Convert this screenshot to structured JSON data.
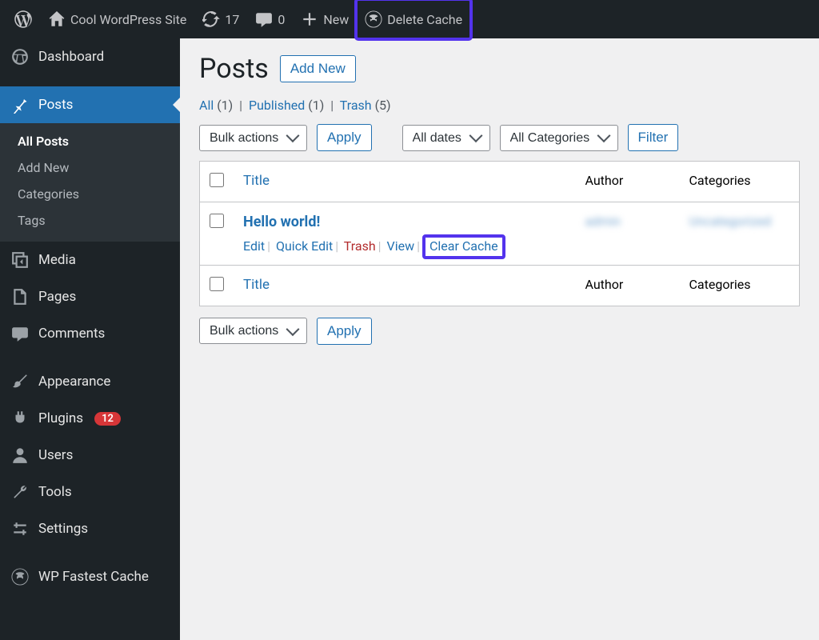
{
  "adminbar": {
    "site_name": "Cool WordPress Site",
    "updates_count": "17",
    "comments_count": "0",
    "new_label": "New",
    "delete_cache_label": "Delete Cache"
  },
  "sidebar": {
    "items": [
      {
        "id": "dashboard",
        "label": "Dashboard"
      },
      {
        "id": "posts",
        "label": "Posts"
      },
      {
        "id": "media",
        "label": "Media"
      },
      {
        "id": "pages",
        "label": "Pages"
      },
      {
        "id": "comments",
        "label": "Comments"
      },
      {
        "id": "appearance",
        "label": "Appearance"
      },
      {
        "id": "plugins",
        "label": "Plugins"
      },
      {
        "id": "users",
        "label": "Users"
      },
      {
        "id": "tools",
        "label": "Tools"
      },
      {
        "id": "settings",
        "label": "Settings"
      },
      {
        "id": "wpfc",
        "label": "WP Fastest Cache"
      }
    ],
    "plugins_badge": "12",
    "posts_submenu": {
      "all": "All Posts",
      "add_new": "Add New",
      "categories": "Categories",
      "tags": "Tags"
    }
  },
  "page": {
    "title": "Posts",
    "add_new": "Add New"
  },
  "views": {
    "all_label": "All",
    "all_count": "(1)",
    "published_label": "Published",
    "published_count": "(1)",
    "trash_label": "Trash",
    "trash_count": "(5)"
  },
  "filters": {
    "bulk_actions": "Bulk actions",
    "apply": "Apply",
    "all_dates": "All dates",
    "all_categories": "All Categories",
    "filter": "Filter"
  },
  "table": {
    "col_title": "Title",
    "col_author": "Author",
    "col_categories": "Categories",
    "row1": {
      "title": "Hello world!",
      "author_blur": "admin",
      "categories_blur": "Uncategorized",
      "actions": {
        "edit": "Edit",
        "quick_edit": "Quick Edit",
        "trash": "Trash",
        "view": "View",
        "clear_cache": "Clear Cache"
      }
    }
  }
}
